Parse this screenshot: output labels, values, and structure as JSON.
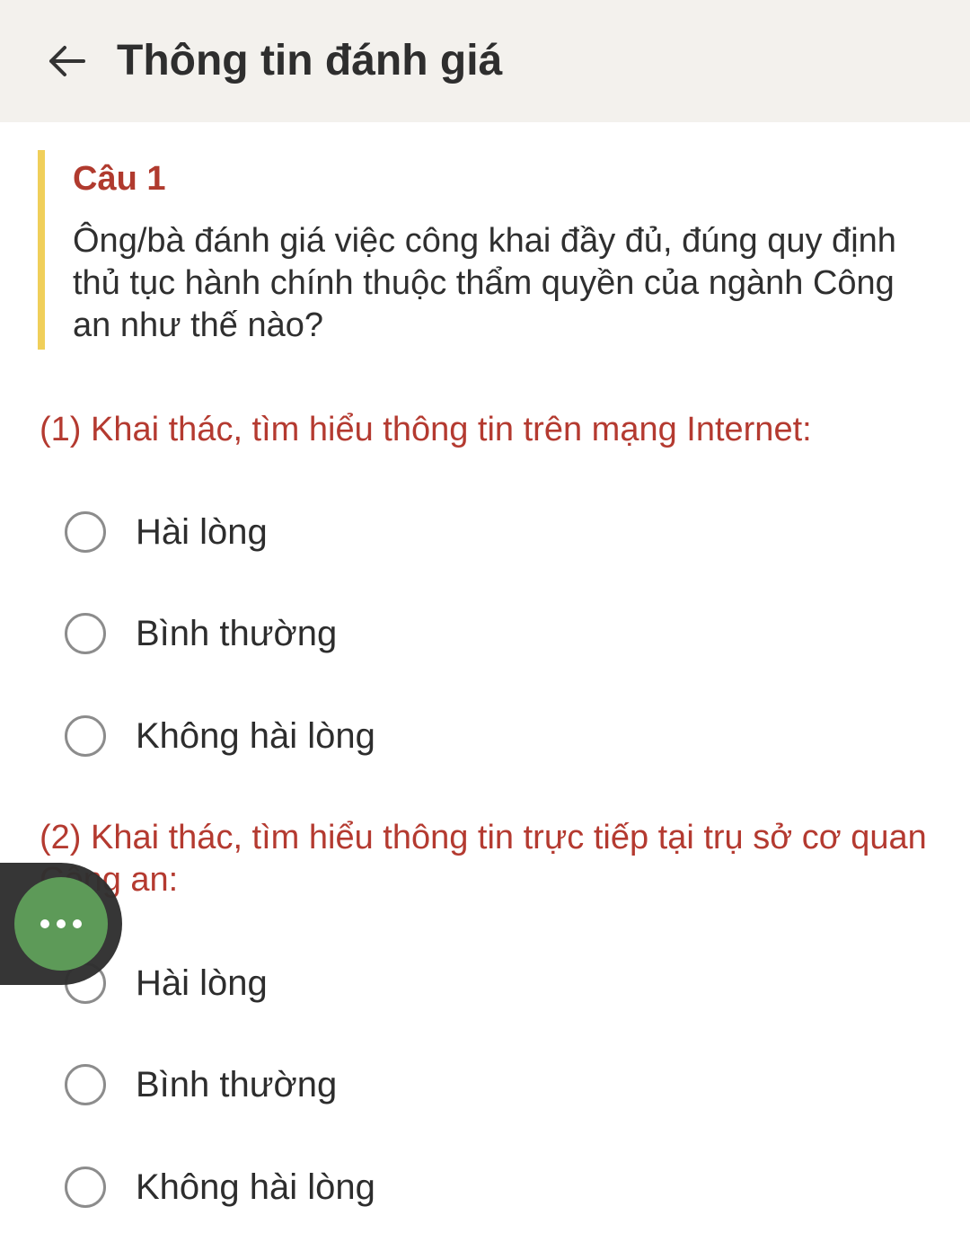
{
  "header": {
    "title": "Thông tin đánh giá",
    "back_icon": "arrow-left-icon"
  },
  "question": {
    "number": "Câu 1",
    "text": "Ông/bà đánh giá việc công khai đầy đủ, đúng quy định thủ tục hành chính thuộc thẩm quyền của ngành Công an như thế nào?",
    "accent_color": "#f0cf5a"
  },
  "sections": [
    {
      "title": "(1) Khai thác, tìm hiểu thông tin trên mạng Internet:",
      "options": [
        "Hài lòng",
        "Bình thường",
        "Không hài lòng"
      ]
    },
    {
      "title": "(2) Khai thác, tìm hiểu thông tin trực tiếp tại trụ sở cơ quan Công an:",
      "options": [
        "Hài lòng",
        "Bình thường",
        "Không hài lòng"
      ]
    }
  ],
  "floating_button": {
    "icon": "more-dots-icon",
    "color": "#5d9a58"
  },
  "colors": {
    "header_bg": "#f3f1ed",
    "section_title": "#b43a30",
    "question_number": "#b03a2e"
  }
}
